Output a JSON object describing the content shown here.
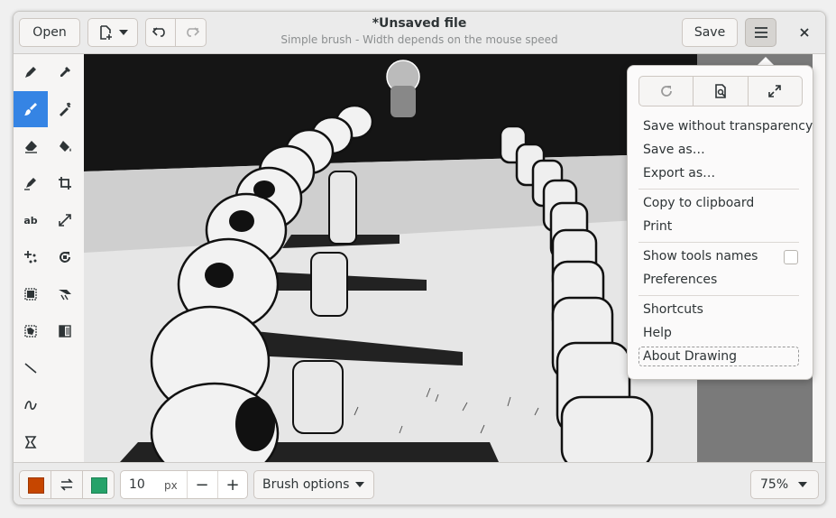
{
  "header": {
    "open_label": "Open",
    "title": "*Unsaved file",
    "subtitle": "Simple brush - Width depends on the mouse speed",
    "save_label": "Save"
  },
  "tools": [
    {
      "name": "pencil",
      "icon": "pencil-icon"
    },
    {
      "name": "color-picker",
      "icon": "eyedropper-icon"
    },
    {
      "name": "brush",
      "icon": "brush-icon",
      "active": true
    },
    {
      "name": "magic-wand",
      "icon": "magic-wand-icon"
    },
    {
      "name": "eraser",
      "icon": "eraser-icon"
    },
    {
      "name": "fill",
      "icon": "paint-bucket-icon"
    },
    {
      "name": "highlighter",
      "icon": "highlighter-icon"
    },
    {
      "name": "crop",
      "icon": "crop-icon"
    },
    {
      "name": "text",
      "icon": "text-icon",
      "label": "ab"
    },
    {
      "name": "scale",
      "icon": "scale-icon"
    },
    {
      "name": "points",
      "icon": "points-icon"
    },
    {
      "name": "rotate",
      "icon": "rotate-icon"
    },
    {
      "name": "rect-selection",
      "icon": "rect-selection-icon"
    },
    {
      "name": "skew",
      "icon": "skew-icon"
    },
    {
      "name": "free-selection",
      "icon": "free-selection-icon"
    },
    {
      "name": "filters",
      "icon": "filters-icon"
    },
    {
      "name": "line",
      "icon": "line-icon"
    },
    {
      "name": "curve",
      "icon": "curve-icon"
    },
    {
      "name": "shape",
      "icon": "shape-icon"
    }
  ],
  "bottombar": {
    "primary_color": "#c64600",
    "secondary_color": "#26a269",
    "size_value": "10",
    "size_unit": "px",
    "minus": "−",
    "plus": "+",
    "options_label": "Brush options",
    "zoom_label": "75%"
  },
  "menu": {
    "items": {
      "save_without_transparency": "Save without transparency",
      "save_as": "Save as…",
      "export_as": "Export as…",
      "copy_to_clipboard": "Copy to clipboard",
      "print": "Print",
      "show_tools_names": "Show tools names",
      "preferences": "Preferences",
      "shortcuts": "Shortcuts",
      "help": "Help",
      "about": "About Drawing"
    },
    "show_tools_names_checked": false
  },
  "colors": {
    "accent": "#3584e4"
  }
}
